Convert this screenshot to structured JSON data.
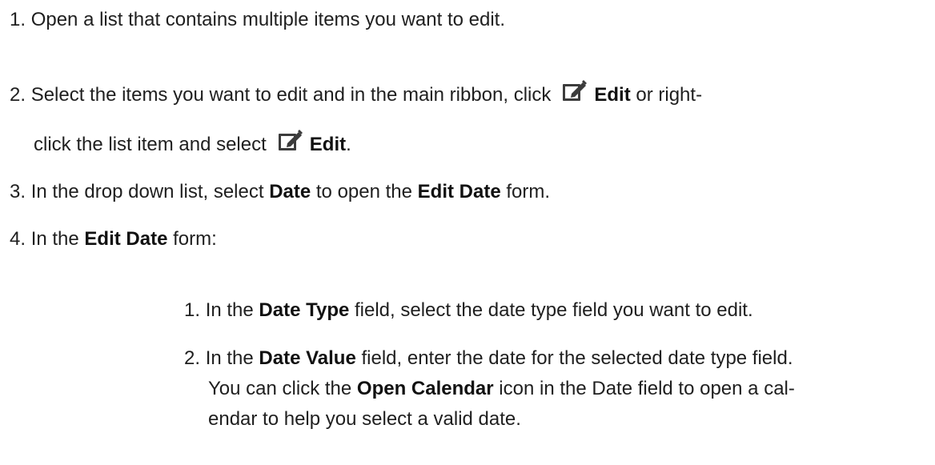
{
  "steps": {
    "s1": {
      "num": "1.",
      "text": "Open a list that contains multiple items you want to edit."
    },
    "s2": {
      "num": "2.",
      "a": "Select the items you want to edit and in the main ribbon, click",
      "edit1": "Edit",
      "b": "or right-",
      "c": "click the list item and select",
      "edit2": "Edit",
      "d": "."
    },
    "s3": {
      "num": "3.",
      "a": "In the drop down list, select",
      "date": "Date",
      "b": "to open the",
      "form": "Edit Date",
      "c": "form."
    },
    "s4": {
      "num": "4.",
      "a": "In the",
      "form": "Edit Date",
      "b": "form:"
    }
  },
  "substeps": {
    "s1": {
      "num": "1.",
      "a": "In the",
      "field": "Date Type",
      "b": "field, select the date type field you want to edit."
    },
    "s2": {
      "num": "2.",
      "a": "In the",
      "field": "Date Value",
      "b": "field, enter the date for the selected date type field.",
      "c": "You can click the",
      "icon": "Open Calendar",
      "d": "icon in the Date field to open a cal-",
      "e": "endar to help you select a valid date."
    }
  },
  "icons": {
    "edit": "edit-pencil-icon",
    "color": "#3c3c3c"
  }
}
